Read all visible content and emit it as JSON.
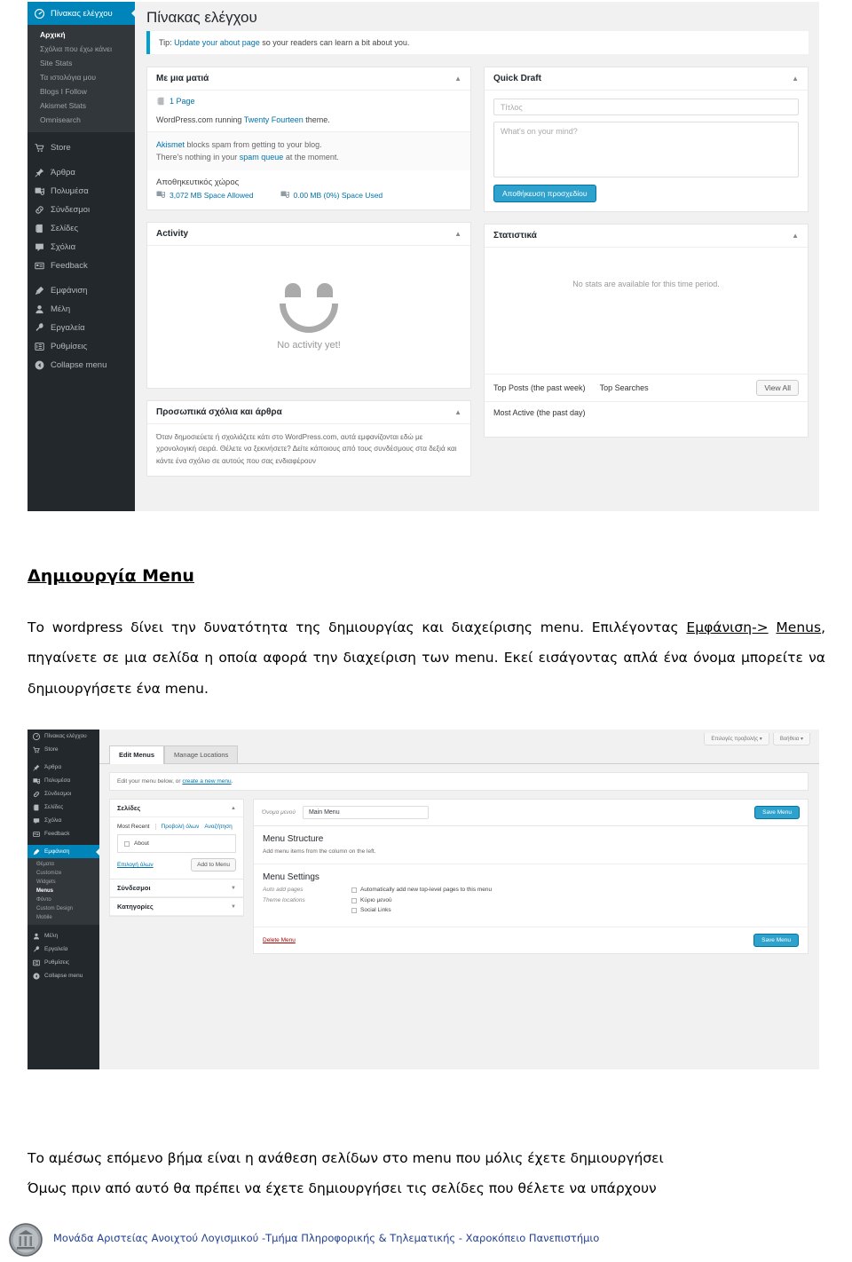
{
  "document": {
    "heading": "Δημιουργία Menu",
    "paragraph1_part1": "Το wordpress δίνει την δυνατότητα της δημιουργίας και διαχείρισης menu. Επιλέγοντας ",
    "paragraph1_link1": "Εμφάνιση->",
    "paragraph1_link2": "Menus",
    "paragraph1_part2": ", πηγαίνετε σε μια σελίδα η οποία αφορά την διαχείριση των menu. Εκεί εισάγοντας απλά ένα όνομα μπορείτε να δημιουργήσετε ένα menu.",
    "paragraph2_line1": "Το αμέσως επόμενο βήμα είναι η ανάθεση σελίδων στο menu που μόλις έχετε δημιουργήσει",
    "paragraph2_line2": "Όμως πριν από αυτό θα πρέπει να έχετε δημιουργήσει τις σελίδες που θέλετε να υπάρχουν",
    "footer": "Μονάδα Αριστείας Ανοιχτού Λογισμικού  -Τμήμα Πληροφορικής & Τηλεματικής - Χαροκόπειο Πανεπιστήμιο",
    "footer_logo_alt": "university-seal"
  },
  "colors": {
    "wp_blue": "#0085ba",
    "wp_sidebar": "#23282d",
    "wp_submenu": "#32373c",
    "link": "#0073aa",
    "button_primary": "#2ea2cc",
    "notice_accent": "#00a0d2",
    "delete": "#a00000",
    "footer_text": "#1f3f94"
  },
  "dashboard": {
    "brand": "Πίνακας ελέγχου",
    "submenu": [
      {
        "label": "Αρχική",
        "active": true
      },
      {
        "label": "Σχόλια που έχω κάνει",
        "active": false
      },
      {
        "label": "Site Stats",
        "active": false
      },
      {
        "label": "Τα ιστολόγια μου",
        "active": false
      },
      {
        "label": "Blogs I Follow",
        "active": false
      },
      {
        "label": "Akismet Stats",
        "active": false
      },
      {
        "label": "Omnisearch",
        "active": false
      }
    ],
    "menu_items": [
      {
        "label": "Store",
        "icon": "cart-icon"
      },
      {
        "label": "Άρθρα",
        "icon": "pin-icon"
      },
      {
        "label": "Πολυμέσα",
        "icon": "media-icon"
      },
      {
        "label": "Σύνδεσμοι",
        "icon": "link-icon"
      },
      {
        "label": "Σελίδες",
        "icon": "page-icon"
      },
      {
        "label": "Σχόλια",
        "icon": "comment-icon"
      },
      {
        "label": "Feedback",
        "icon": "feedback-icon"
      },
      {
        "label": "Εμφάνιση",
        "icon": "brush-icon"
      },
      {
        "label": "Μέλη",
        "icon": "user-icon"
      },
      {
        "label": "Εργαλεία",
        "icon": "wrench-icon"
      },
      {
        "label": "Ρυθμίσεις",
        "icon": "settings-icon"
      },
      {
        "label": "Collapse menu",
        "icon": "collapse-icon"
      }
    ],
    "page_title": "Πίνακας ελέγχου",
    "tip": {
      "prefix": "Tip: ",
      "link": "Update your about page",
      "suffix": " so your readers can learn a bit about you."
    },
    "glance": {
      "title": "Με μια ματιά",
      "pages_count": "1 Page",
      "theme_prefix": "WordPress.com running ",
      "theme_name": "Twenty Fourteen",
      "theme_suffix": " theme.",
      "akismet_link": "Akismet",
      "akismet_line1": " blocks spam from getting to your blog.",
      "akismet_line2_prefix": "There's nothing in your ",
      "akismet_link2": "spam queue",
      "akismet_line2_suffix": " at the moment.",
      "storage_label": "Αποθηκευτικός χώρος",
      "space_allowed": "3,072 MB Space Allowed",
      "space_used": "0.00 MB (0%) Space Used"
    },
    "activity": {
      "title": "Activity",
      "empty": "No activity yet!",
      "smiley_icon": "smiley-face-icon"
    },
    "personal": {
      "title": "Προσωπικά σχόλια και άρθρα",
      "body": "Όταν δημοσιεύετε ή σχολιάζετε κάτι στο WordPress.com, αυτά εμφανίζονται εδώ με χρονολογική σειρά. Θέλετε να ξεκινήσετε? Δείτε κάποιους από τους συνδέσμους στα δεξιά και κάντε ένα σχόλιο σε αυτούς που σας ενδιαφέρουν"
    },
    "quick_draft": {
      "title": "Quick Draft",
      "title_placeholder": "Τίτλος",
      "content_placeholder": "What's on your mind?",
      "save_label": "Αποθήκευση προσχεδίου"
    },
    "stats": {
      "title": "Στατιστικά",
      "empty": "No stats are available for this time period.",
      "tab_top_posts": "Top Posts (the past week)",
      "tab_top_searches": "Top Searches",
      "view_all": "View All",
      "most_active": "Most Active (the past day)"
    }
  },
  "menus_screen": {
    "menu_items": [
      {
        "label": "Πίνακας ελέγχου",
        "icon": "dashboard-icon"
      },
      {
        "label": "Store",
        "icon": "cart-icon"
      },
      {
        "label": "Άρθρα",
        "icon": "pin-icon"
      },
      {
        "label": "Πολυμέσα",
        "icon": "media-icon"
      },
      {
        "label": "Σύνδεσμοι",
        "icon": "link-icon"
      },
      {
        "label": "Σελίδες",
        "icon": "page-icon"
      },
      {
        "label": "Σχόλια",
        "icon": "comment-icon"
      },
      {
        "label": "Feedback",
        "icon": "feedback-icon"
      },
      {
        "label": "Εμφάνιση",
        "icon": "brush-icon",
        "current": true
      }
    ],
    "appearance_submenu": [
      {
        "label": "Θέματα",
        "active": false
      },
      {
        "label": "Customize",
        "active": false
      },
      {
        "label": "Widgets",
        "active": false
      },
      {
        "label": "Menus",
        "active": true
      },
      {
        "label": "Φόντο",
        "active": false
      },
      {
        "label": "Custom Design",
        "active": false
      },
      {
        "label": "Mobile",
        "active": false
      }
    ],
    "tail_items": [
      {
        "label": "Μέλη",
        "icon": "user-icon"
      },
      {
        "label": "Εργαλεία",
        "icon": "wrench-icon"
      },
      {
        "label": "Ρυθμίσεις",
        "icon": "settings-icon"
      },
      {
        "label": "Collapse menu",
        "icon": "collapse-icon"
      }
    ],
    "screen_options": "Επιλογές προβολής",
    "help": "Βοήθεια",
    "tab_edit_menus": "Edit Menus",
    "tab_manage_locations": "Manage Locations",
    "edit_note_prefix": "Edit your menu below, or ",
    "edit_note_link": "create a new menu",
    "edit_note_suffix": ".",
    "pages_panel": {
      "title": "Σελίδες",
      "tab_most_recent": "Most Recent",
      "tab_view_all": "Προβολή όλων",
      "tab_search": "Αναζήτηση",
      "item_about": "About",
      "select_all": "Επιλογή όλων",
      "add_to_menu": "Add to Menu"
    },
    "links_panel": {
      "title": "Σύνδεσμοι"
    },
    "categories_panel": {
      "title": "Κατηγορίες"
    },
    "menu_name_label": "Όνομα μενού",
    "menu_name_value": "Main Menu",
    "save_menu": "Save Menu",
    "structure_heading": "Menu Structure",
    "structure_hint": "Add menu items from the column on the left.",
    "settings_heading": "Menu Settings",
    "auto_add_label": "Auto add pages",
    "auto_add_option": "Automatically add new top-level pages to this menu",
    "theme_locations_label": "Theme locations",
    "theme_location_main": "Κύριο μενού",
    "theme_location_social": "Social Links",
    "delete_menu": "Delete Menu"
  }
}
